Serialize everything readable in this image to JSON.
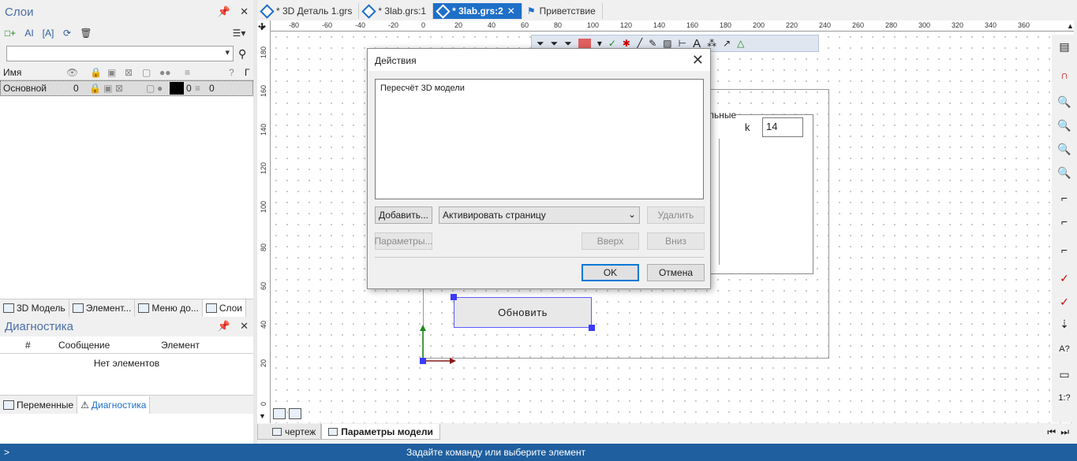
{
  "layers_panel": {
    "title": "Слои",
    "columns": [
      "Имя",
      "0",
      "Г"
    ],
    "row": {
      "name": "Основной",
      "v1": "0",
      "v2": "0",
      "v3": "0"
    }
  },
  "left_tabs": [
    "3D Модель",
    "Элемент...",
    "Меню до...",
    "Слои"
  ],
  "diagnostics": {
    "title": "Диагностика",
    "columns": [
      "#",
      "Сообщение",
      "Элемент"
    ],
    "empty": "Нет элементов"
  },
  "bottom_left_tabs": [
    "Переменные",
    "Диагностика"
  ],
  "doc_tabs": [
    "* 3D Деталь 1.grs",
    "* 3lab.grs:1",
    "* 3lab.grs:2",
    "Приветствие"
  ],
  "ruler_labels": [
    "-80",
    "-60",
    "-40",
    "-20",
    "0",
    "20",
    "40",
    "60",
    "80",
    "100",
    "120",
    "140",
    "160",
    "180",
    "200",
    "220",
    "240",
    "260",
    "280",
    "300",
    "320",
    "340",
    "360"
  ],
  "vruler_labels": [
    "180",
    "160",
    "140",
    "120",
    "100",
    "80",
    "60",
    "40",
    "20",
    "0"
  ],
  "canvas": {
    "group_label": "льные",
    "var_k_label": "k",
    "var_k_value": "14",
    "update_button": "Обновить"
  },
  "dialog": {
    "title": "Действия",
    "list_item": "Пересчёт 3D модели",
    "add_button": "Добавить...",
    "action_select": "Активировать страницу",
    "delete_button": "Удалить",
    "params_button": "Параметры...",
    "up_button": "Вверх",
    "down_button": "Вниз",
    "ok_button": "OK",
    "cancel_button": "Отмена"
  },
  "page_tabs": [
    "чертеж",
    "Параметры модели"
  ],
  "status": {
    "prompt": ">",
    "message": "Задайте команду или выберите элемент"
  },
  "colors": {
    "accent": "#1e6fc8",
    "status_bar": "#1f5f9f",
    "handle": "#3b3bff",
    "axis_y": "#1a8a1a",
    "axis_x": "#8a1a1a"
  }
}
